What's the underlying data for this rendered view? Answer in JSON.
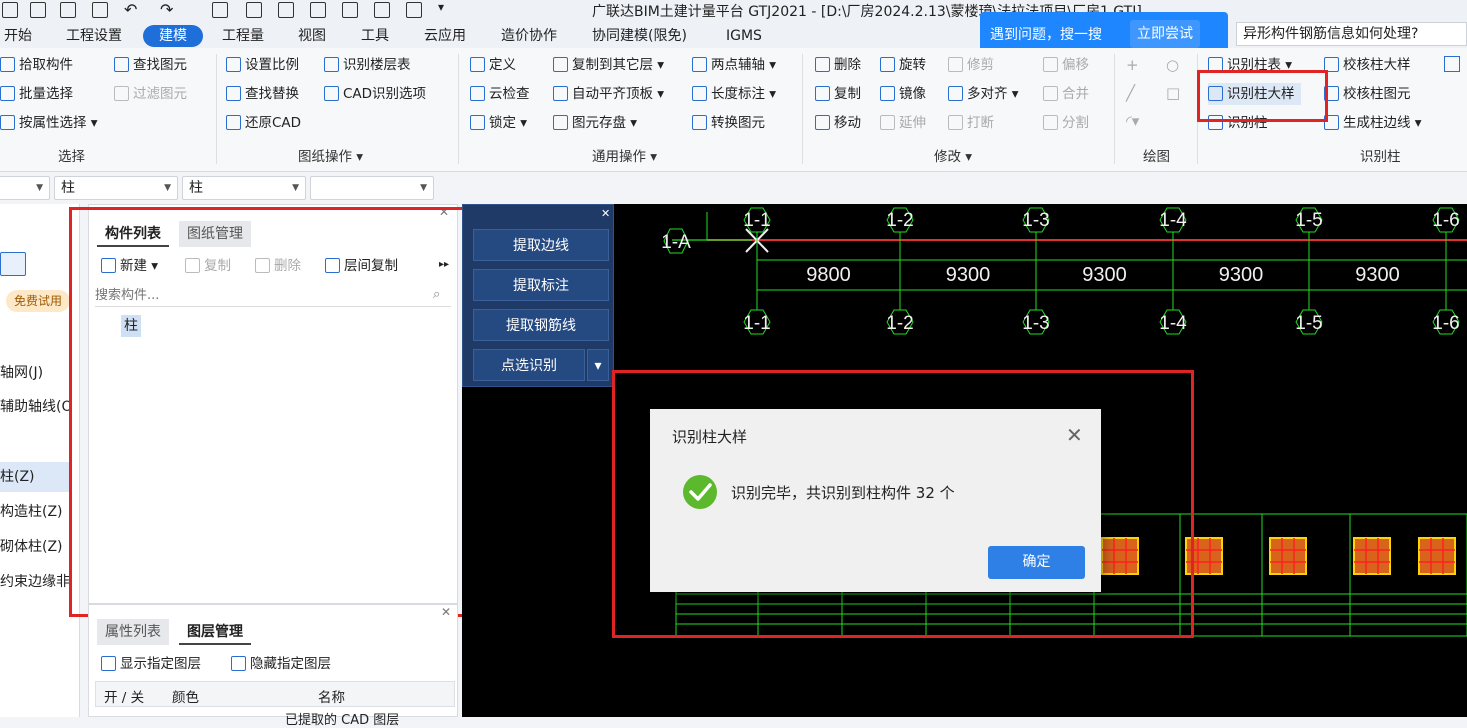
{
  "window": {
    "title": "广联达BIM土建计量平台 GTJ2021 - [D:\\厂房2024.2.13\\蒙楼璋\\法拉法项目\\厂房1.GTJ]"
  },
  "menu": {
    "items": [
      "开始",
      "工程设置",
      "建模",
      "工程量",
      "视图",
      "工具",
      "云应用",
      "造价协作",
      "协同建模(限免)",
      "IGMS"
    ],
    "active": "建模"
  },
  "tip": {
    "text": "遇到问题，搜一搜",
    "button": "立即尝试"
  },
  "search": {
    "value": "异形构件钢筋信息如何处理?"
  },
  "ribbon": {
    "select": {
      "items": [
        "拾取构件",
        "批量选择",
        "按属性选择"
      ],
      "items2": [
        "查找图元",
        "过滤图元"
      ],
      "label": "选择"
    },
    "drawing": {
      "items": [
        "设置比例",
        "查找替换",
        "还原CAD",
        "识别楼层表",
        "CAD识别选项"
      ],
      "label": "图纸操作"
    },
    "general": {
      "items": [
        "定义",
        "云检查",
        "锁定",
        "复制到其它层",
        "自动平齐顶板",
        "图元存盘",
        "两点辅轴",
        "长度标注",
        "转换图元"
      ],
      "label": "通用操作"
    },
    "modify": {
      "items": [
        "删除",
        "复制",
        "移动",
        "旋转",
        "镜像",
        "延伸",
        "修剪",
        "多对齐",
        "打断",
        "偏移",
        "合并",
        "分割"
      ],
      "label": "修改"
    },
    "draw": {
      "label": "绘图"
    },
    "recog": {
      "items": [
        "识别柱表",
        "识别柱大样",
        "识别柱",
        "校核柱大样",
        "校核柱图元",
        "生成柱边线"
      ],
      "label": "识别柱"
    }
  },
  "filters": {
    "floor": "",
    "type": "柱",
    "sub": "柱",
    "extra": ""
  },
  "leftnav": {
    "badge": "免费试用",
    "items": [
      "轴网(J)",
      "辅助轴线(O)",
      "柱(Z)",
      "构造柱(Z)",
      "砌体柱(Z)",
      "约束边缘非..."
    ]
  },
  "components": {
    "tabs": [
      "构件列表",
      "图纸管理"
    ],
    "new": "新建",
    "copy": "复制",
    "delete": "删除",
    "floor_copy": "层间复制",
    "search_placeholder": "搜索构件...",
    "items": [
      "柱"
    ]
  },
  "layers": {
    "tabs": [
      "属性列表",
      "图层管理"
    ],
    "show": "显示指定图层",
    "hide": "隐藏指定图层",
    "cols": [
      "开 / 关",
      "颜色",
      "名称"
    ],
    "row": "已提取的 CAD 图层"
  },
  "cad": {
    "buttons": [
      "提取边线",
      "提取标注",
      "提取钢筋线",
      "点选识别"
    ]
  },
  "drawing": {
    "top_axes": [
      "1-1",
      "1-2",
      "1-3",
      "1-4",
      "1-5",
      "1-6"
    ],
    "bottom_axes": [
      "1-1",
      "1-2",
      "1-3",
      "1-4",
      "1-5",
      "1-6"
    ],
    "row_axis": "1-A",
    "dims": [
      "9800",
      "9300",
      "9300",
      "9300",
      "9300"
    ]
  },
  "dialog": {
    "title": "识别柱大样",
    "message": "识别完毕，共识别到柱构件 32 个",
    "ok": "确定"
  }
}
